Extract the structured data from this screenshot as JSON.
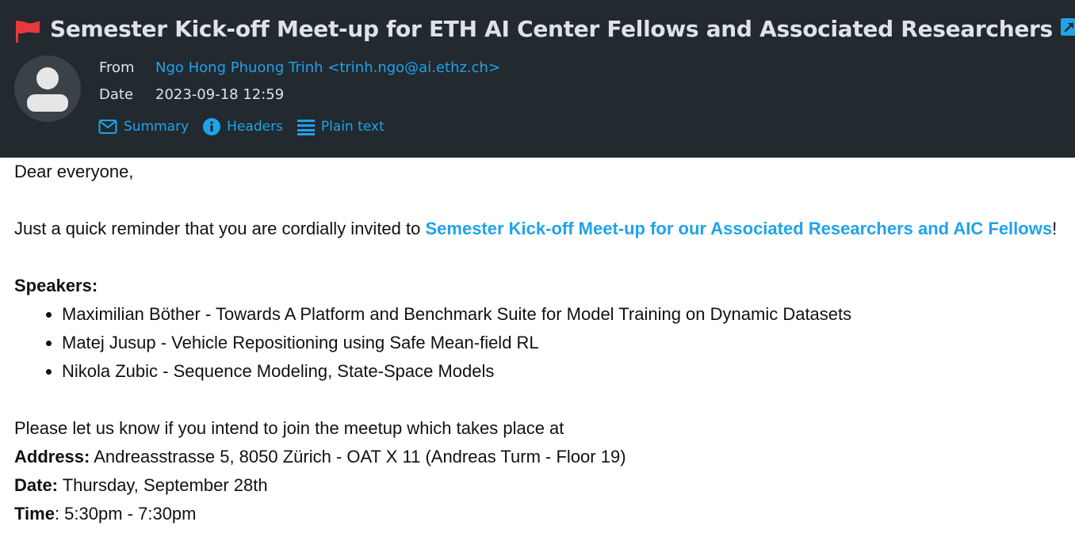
{
  "email": {
    "subject": "Semester Kick-off Meet-up for ETH AI Center Fellows and Associated Researchers",
    "from_label": "From",
    "from_value": "Ngo Hong Phuong Trinh <trinh.ngo@ai.ethz.ch>",
    "date_label": "Date",
    "date_value": "2023-09-18 12:59",
    "actions": {
      "summary": "Summary",
      "headers": "Headers",
      "plain_text": "Plain text"
    },
    "icons": [
      "flag-icon",
      "external-link-icon",
      "avatar-icon",
      "envelope-icon",
      "info-icon",
      "list-icon"
    ],
    "colors": {
      "header_bg": "#22292f",
      "accent": "#1fa3ec",
      "flag": "#e8383d"
    }
  },
  "body": {
    "greeting": "Dear everyone,",
    "intro_before": "Just a quick reminder that you are cordially invited to ",
    "intro_link": "Semester Kick-off Meet-up for our Associated Researchers and AIC Fellows",
    "intro_after": "!",
    "speakers_heading": "Speakers:",
    "speakers": [
      "Maximilian Böther - Towards A Platform and Benchmark Suite for Model Training on Dynamic Datasets",
      "Matej Jusup - Vehicle Repositioning using Safe Mean-field RL",
      "Nikola Zubic - Sequence Modeling, State-Space Models"
    ],
    "rsvp": "Please let us know if you intend to join the meetup which takes place at",
    "address_label": "Address:",
    "address_value": " Andreasstrasse 5, 8050 Zürich - OAT X 11 (Andreas Turm - Floor 19)",
    "date_label": "Date:",
    "date_value": " Thursday, September 28th",
    "time_label": "Time",
    "time_value": ": 5:30pm - 7:30pm"
  }
}
